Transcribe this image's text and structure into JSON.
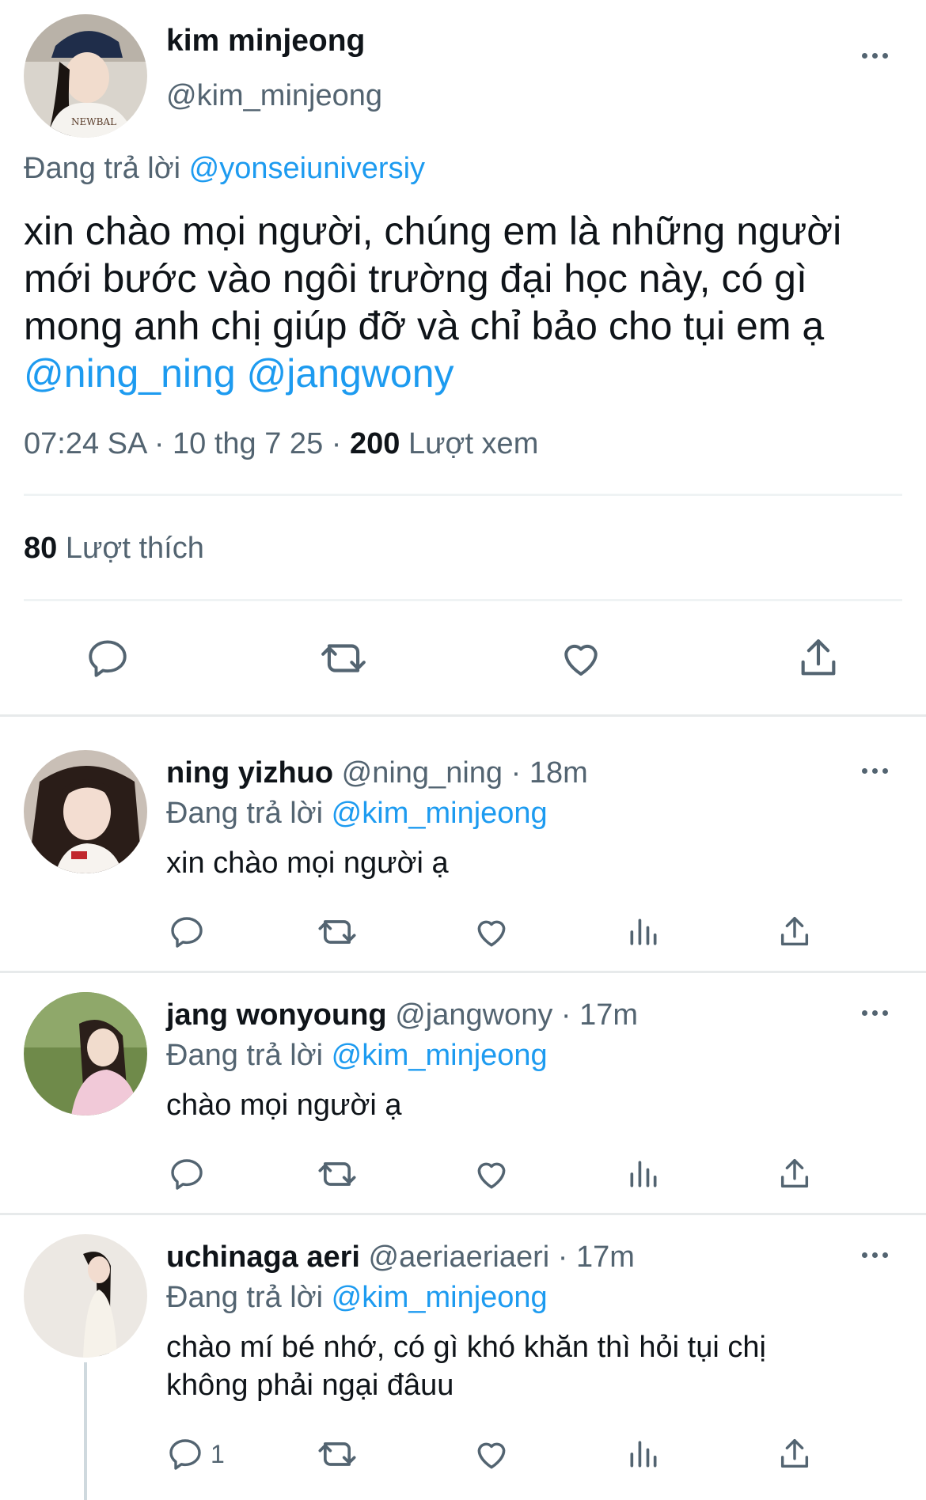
{
  "main_tweet": {
    "name": "kim minjeong",
    "handle": "@kim_minjeong",
    "replying_prefix": "Đang trả lời",
    "replying_to": "@yonseiuniversiy",
    "text": "xin chào mọi người, chúng em là những người mới bước vào ngôi trường đại học này, có gì mong anh chị giúp đỡ và chỉ bảo cho tụi em ạ",
    "mentions": "@ning_ning @jangwony",
    "time": "07:24 SA",
    "date": "10 thg 7 25",
    "views_count": "200",
    "views_label": "Lượt xem",
    "likes_count": "80",
    "likes_label": "Lượt thích",
    "icons": [
      "reply-icon",
      "retweet-icon",
      "like-icon",
      "share-icon"
    ]
  },
  "replies": [
    {
      "name": "ning yizhuo",
      "handle": "@ning_ning",
      "time": "18m",
      "replying_prefix": "Đang trả lời",
      "replying_to": "@kim_minjeong",
      "text": "xin chào mọi người ạ",
      "reply_count": ""
    },
    {
      "name": "jang wonyoung",
      "handle": "@jangwony",
      "time": "17m",
      "replying_prefix": "Đang trả lời",
      "replying_to": "@kim_minjeong",
      "text": "chào mọi người ạ",
      "reply_count": ""
    },
    {
      "name": "uchinaga aeri",
      "handle": "@aeriaeriaeri",
      "time": "17m",
      "replying_prefix": "Đang trả lời",
      "replying_to": "@kim_minjeong",
      "text": "chào mí bé nhớ, có gì khó khăn thì hỏi tụi chị không phải ngại đâuu",
      "reply_count": "1"
    }
  ],
  "colors": {
    "accent": "#1d9bf0",
    "secondary_text": "#536471",
    "primary_text": "#0f1419",
    "divider": "#eff3f4"
  }
}
